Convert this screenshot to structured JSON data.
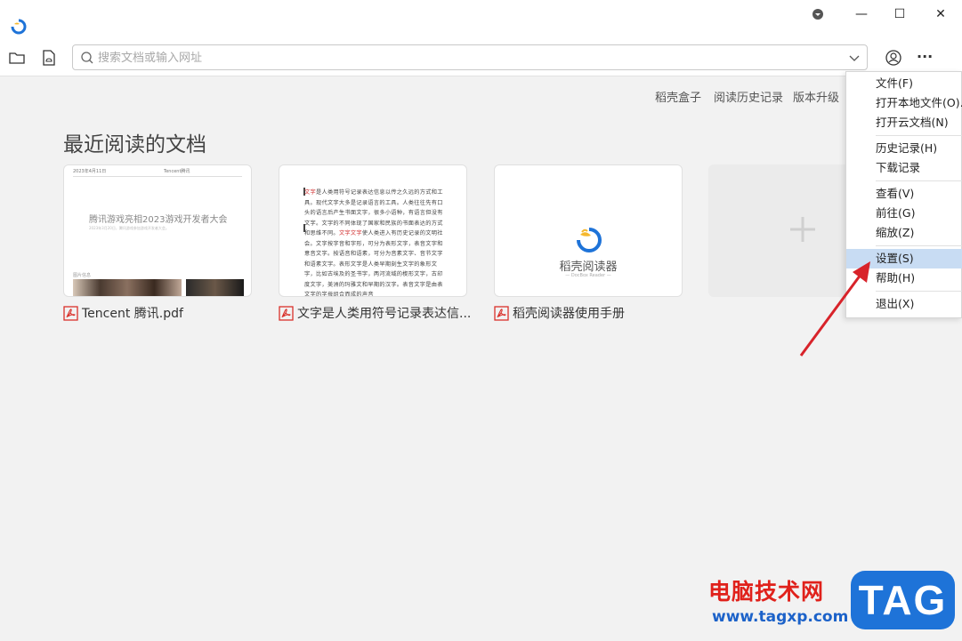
{
  "window": {
    "title_icons": [
      "app-logo-icon",
      "dropdown-circle-icon",
      "minimize-icon",
      "maximize-icon",
      "close-icon"
    ],
    "minimize_glyph": "—",
    "maximize_glyph": "☐",
    "close_glyph": "✕"
  },
  "toolbar": {
    "open_folder_icon": "folder-icon",
    "cloud_file_icon": "cloud-file-icon",
    "search_placeholder": "搜索文档或输入网址",
    "search_value": "",
    "account_icon": "user-icon",
    "more_glyph": "···"
  },
  "top_links": [
    "稻壳盒子",
    "阅读历史记录",
    "版本升级"
  ],
  "section_title": "最近阅读的文档",
  "cards": [
    {
      "label": "Tencent 腾讯.pdf",
      "preview_header_left": "2023年4月11日",
      "preview_header_right": "Tencent腾讯",
      "preview_title": "腾讯游戏亮相2023游戏开发者大会",
      "preview_sub": "2023年3月20日，腾讯游戏参加游戏开发者大会。",
      "preview_footer": "图片信息"
    },
    {
      "label": "文字是人类用符号记录表达信...",
      "preview_red": "文字",
      "preview_lines": [
        "是人类用符号记录表达信息以传之久远的方",
        "式和工具。现代文字大多是记录语言的工具。人类往",
        "往先有口头的语言后产生书面文字，很多小语种，有",
        "语言但没有文字。文字的不同体现了国家和民族的书",
        "面表达的方式和思维不同。",
        "使人类进入有历",
        "史记录的文明社会。文字按字音和字形，可分为表形",
        "文字，表音文字和意音文字。按语音和语素，可分为",
        "音素文字、音节文字和语素文字。表形文字是人类早",
        "期刻生文字的象形文字，比如古埃及的圣书字，两河",
        "流域的楔形文字，古印度文字，美洲的玛雅文和早期",
        "的汉字。表音文字是由表文字的字母组合而成的声音"
      ],
      "preview_red_inline": "文字文字"
    },
    {
      "label": "稻壳阅读器使用手册",
      "preview_name": "稻壳阅读器",
      "preview_sub": "— DocBox Reader —"
    }
  ],
  "add_card_icon": "plus-icon",
  "menu": {
    "items": [
      {
        "label": "文件(F)",
        "sep_after": false
      },
      {
        "label": "打开本地文件(O)...",
        "sep_after": false
      },
      {
        "label": "打开云文档(N)",
        "sep_after": true
      },
      {
        "label": "历史记录(H)",
        "sep_after": false
      },
      {
        "label": "下载记录",
        "sep_after": true
      },
      {
        "label": "查看(V)",
        "sep_after": false
      },
      {
        "label": "前往(G)",
        "sep_after": false
      },
      {
        "label": "缩放(Z)",
        "sep_after": true
      },
      {
        "label": "设置(S)",
        "sep_after": false,
        "active": true
      },
      {
        "label": "帮助(H)",
        "sep_after": true
      },
      {
        "label": "退出(X)",
        "sep_after": false
      }
    ]
  },
  "watermark": {
    "cn": "电脑技术网",
    "url": "www.tagxp.com",
    "tag": "TAG"
  },
  "colors": {
    "accent_blue": "#1e73d8",
    "menu_highlight": "#c8dcf3",
    "pdf_red": "#d9312b",
    "arrow_red": "#d8232a"
  }
}
